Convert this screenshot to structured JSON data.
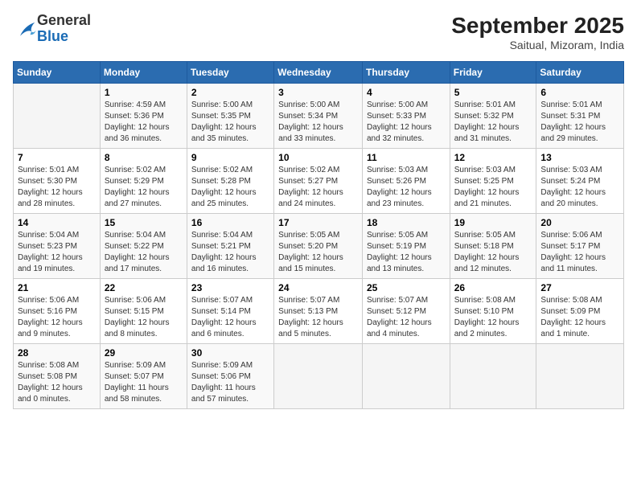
{
  "header": {
    "logo_general": "General",
    "logo_blue": "Blue",
    "month_title": "September 2025",
    "subtitle": "Saitual, Mizoram, India"
  },
  "calendar": {
    "days_of_week": [
      "Sunday",
      "Monday",
      "Tuesday",
      "Wednesday",
      "Thursday",
      "Friday",
      "Saturday"
    ],
    "weeks": [
      [
        {
          "day": "",
          "info": ""
        },
        {
          "day": "1",
          "info": "Sunrise: 4:59 AM\nSunset: 5:36 PM\nDaylight: 12 hours\nand 36 minutes."
        },
        {
          "day": "2",
          "info": "Sunrise: 5:00 AM\nSunset: 5:35 PM\nDaylight: 12 hours\nand 35 minutes."
        },
        {
          "day": "3",
          "info": "Sunrise: 5:00 AM\nSunset: 5:34 PM\nDaylight: 12 hours\nand 33 minutes."
        },
        {
          "day": "4",
          "info": "Sunrise: 5:00 AM\nSunset: 5:33 PM\nDaylight: 12 hours\nand 32 minutes."
        },
        {
          "day": "5",
          "info": "Sunrise: 5:01 AM\nSunset: 5:32 PM\nDaylight: 12 hours\nand 31 minutes."
        },
        {
          "day": "6",
          "info": "Sunrise: 5:01 AM\nSunset: 5:31 PM\nDaylight: 12 hours\nand 29 minutes."
        }
      ],
      [
        {
          "day": "7",
          "info": "Sunrise: 5:01 AM\nSunset: 5:30 PM\nDaylight: 12 hours\nand 28 minutes."
        },
        {
          "day": "8",
          "info": "Sunrise: 5:02 AM\nSunset: 5:29 PM\nDaylight: 12 hours\nand 27 minutes."
        },
        {
          "day": "9",
          "info": "Sunrise: 5:02 AM\nSunset: 5:28 PM\nDaylight: 12 hours\nand 25 minutes."
        },
        {
          "day": "10",
          "info": "Sunrise: 5:02 AM\nSunset: 5:27 PM\nDaylight: 12 hours\nand 24 minutes."
        },
        {
          "day": "11",
          "info": "Sunrise: 5:03 AM\nSunset: 5:26 PM\nDaylight: 12 hours\nand 23 minutes."
        },
        {
          "day": "12",
          "info": "Sunrise: 5:03 AM\nSunset: 5:25 PM\nDaylight: 12 hours\nand 21 minutes."
        },
        {
          "day": "13",
          "info": "Sunrise: 5:03 AM\nSunset: 5:24 PM\nDaylight: 12 hours\nand 20 minutes."
        }
      ],
      [
        {
          "day": "14",
          "info": "Sunrise: 5:04 AM\nSunset: 5:23 PM\nDaylight: 12 hours\nand 19 minutes."
        },
        {
          "day": "15",
          "info": "Sunrise: 5:04 AM\nSunset: 5:22 PM\nDaylight: 12 hours\nand 17 minutes."
        },
        {
          "day": "16",
          "info": "Sunrise: 5:04 AM\nSunset: 5:21 PM\nDaylight: 12 hours\nand 16 minutes."
        },
        {
          "day": "17",
          "info": "Sunrise: 5:05 AM\nSunset: 5:20 PM\nDaylight: 12 hours\nand 15 minutes."
        },
        {
          "day": "18",
          "info": "Sunrise: 5:05 AM\nSunset: 5:19 PM\nDaylight: 12 hours\nand 13 minutes."
        },
        {
          "day": "19",
          "info": "Sunrise: 5:05 AM\nSunset: 5:18 PM\nDaylight: 12 hours\nand 12 minutes."
        },
        {
          "day": "20",
          "info": "Sunrise: 5:06 AM\nSunset: 5:17 PM\nDaylight: 12 hours\nand 11 minutes."
        }
      ],
      [
        {
          "day": "21",
          "info": "Sunrise: 5:06 AM\nSunset: 5:16 PM\nDaylight: 12 hours\nand 9 minutes."
        },
        {
          "day": "22",
          "info": "Sunrise: 5:06 AM\nSunset: 5:15 PM\nDaylight: 12 hours\nand 8 minutes."
        },
        {
          "day": "23",
          "info": "Sunrise: 5:07 AM\nSunset: 5:14 PM\nDaylight: 12 hours\nand 6 minutes."
        },
        {
          "day": "24",
          "info": "Sunrise: 5:07 AM\nSunset: 5:13 PM\nDaylight: 12 hours\nand 5 minutes."
        },
        {
          "day": "25",
          "info": "Sunrise: 5:07 AM\nSunset: 5:12 PM\nDaylight: 12 hours\nand 4 minutes."
        },
        {
          "day": "26",
          "info": "Sunrise: 5:08 AM\nSunset: 5:10 PM\nDaylight: 12 hours\nand 2 minutes."
        },
        {
          "day": "27",
          "info": "Sunrise: 5:08 AM\nSunset: 5:09 PM\nDaylight: 12 hours\nand 1 minute."
        }
      ],
      [
        {
          "day": "28",
          "info": "Sunrise: 5:08 AM\nSunset: 5:08 PM\nDaylight: 12 hours\nand 0 minutes."
        },
        {
          "day": "29",
          "info": "Sunrise: 5:09 AM\nSunset: 5:07 PM\nDaylight: 11 hours\nand 58 minutes."
        },
        {
          "day": "30",
          "info": "Sunrise: 5:09 AM\nSunset: 5:06 PM\nDaylight: 11 hours\nand 57 minutes."
        },
        {
          "day": "",
          "info": ""
        },
        {
          "day": "",
          "info": ""
        },
        {
          "day": "",
          "info": ""
        },
        {
          "day": "",
          "info": ""
        }
      ]
    ]
  }
}
